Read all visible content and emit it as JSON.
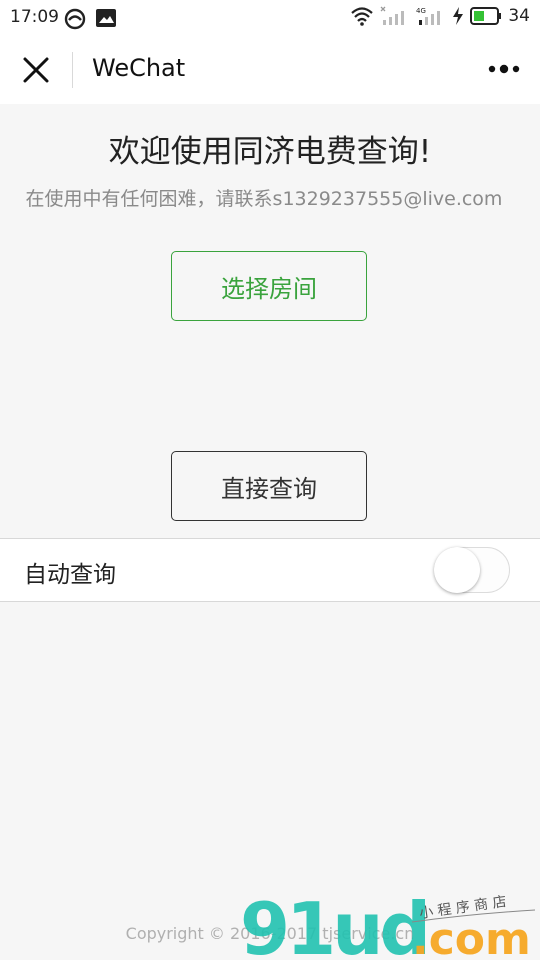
{
  "status_bar": {
    "time": "17:09",
    "battery": "34"
  },
  "nav": {
    "title": "WeChat"
  },
  "main": {
    "welcome": "欢迎使用同济电费查询!",
    "help": "在使用中有任何困难，请联系s1329237555@live.com",
    "select_room_label": "选择房间",
    "direct_query_label": "直接查询",
    "auto_query_label": "自动查询",
    "auto_query_on": false
  },
  "footer": {
    "copyright": "Copyright © 2016-2017 tjservice.cn"
  },
  "watermark": {
    "brand": "91ud.com",
    "tagline": "小程序商店"
  },
  "colors": {
    "accent_green": "#3aa33d",
    "watermark_teal": "#21c2b0",
    "watermark_orange": "#f5a623"
  }
}
